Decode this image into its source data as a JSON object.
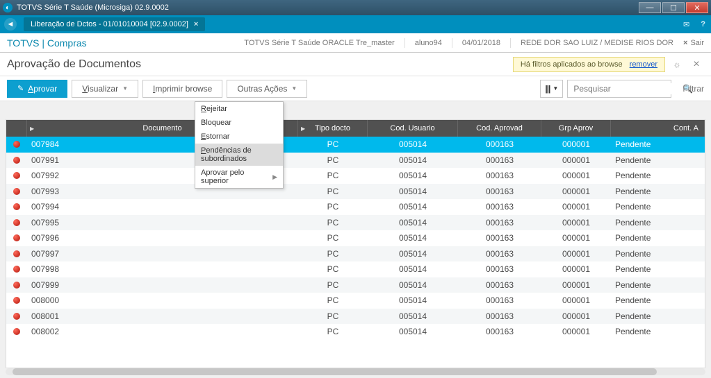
{
  "titlebar": {
    "title": "TOTVS Série T Saúde (Microsiga) 02.9.0002"
  },
  "tab": {
    "label": "Liberação de Dctos - 01/01010004 [02.9.0002]"
  },
  "module": {
    "brand": "TOTVS",
    "section": "Compras"
  },
  "meta": {
    "env": "TOTVS Série T Saúde ORACLE Tre_master",
    "user": "aluno94",
    "date": "04/01/2018",
    "org": "REDE DOR SAO LUIZ / MEDISE RIOS DOR",
    "exit": "Sair"
  },
  "page": {
    "title": "Aprovação de Documentos"
  },
  "filter_notice": {
    "text": "Há filtros aplicados ao browse",
    "link": "remover"
  },
  "toolbar": {
    "aprovar": "Aprovar",
    "visualizar": "Visualizar",
    "imprimir": "Imprimir browse",
    "outras": "Outras Ações",
    "filtrar": "Filtrar",
    "search_placeholder": "Pesquisar"
  },
  "dropdown": {
    "rejeitar": "Rejeitar",
    "bloquear": "Bloquear",
    "estornar": "Estornar",
    "pendencias": "Pendências de subordinados",
    "aprovar_sup": "Aprovar pelo superior"
  },
  "columns": {
    "documento": "Documento",
    "tipo": "Tipo docto",
    "usuario": "Cod. Usuario",
    "aprovad": "Cod. Aprovad",
    "grp": "Grp Aprov",
    "cont": "Cont. A"
  },
  "status_label": "Pendente",
  "rows": [
    {
      "doc": "007984",
      "tipo": "PC",
      "usr": "005014",
      "apr": "000163",
      "grp": "000001",
      "sel": true
    },
    {
      "doc": "007991",
      "tipo": "PC",
      "usr": "005014",
      "apr": "000163",
      "grp": "000001"
    },
    {
      "doc": "007992",
      "tipo": "PC",
      "usr": "005014",
      "apr": "000163",
      "grp": "000001"
    },
    {
      "doc": "007993",
      "tipo": "PC",
      "usr": "005014",
      "apr": "000163",
      "grp": "000001"
    },
    {
      "doc": "007994",
      "tipo": "PC",
      "usr": "005014",
      "apr": "000163",
      "grp": "000001"
    },
    {
      "doc": "007995",
      "tipo": "PC",
      "usr": "005014",
      "apr": "000163",
      "grp": "000001"
    },
    {
      "doc": "007996",
      "tipo": "PC",
      "usr": "005014",
      "apr": "000163",
      "grp": "000001"
    },
    {
      "doc": "007997",
      "tipo": "PC",
      "usr": "005014",
      "apr": "000163",
      "grp": "000001"
    },
    {
      "doc": "007998",
      "tipo": "PC",
      "usr": "005014",
      "apr": "000163",
      "grp": "000001"
    },
    {
      "doc": "007999",
      "tipo": "PC",
      "usr": "005014",
      "apr": "000163",
      "grp": "000001"
    },
    {
      "doc": "008000",
      "tipo": "PC",
      "usr": "005014",
      "apr": "000163",
      "grp": "000001"
    },
    {
      "doc": "008001",
      "tipo": "PC",
      "usr": "005014",
      "apr": "000163",
      "grp": "000001"
    },
    {
      "doc": "008002",
      "tipo": "PC",
      "usr": "005014",
      "apr": "000163",
      "grp": "000001"
    }
  ]
}
